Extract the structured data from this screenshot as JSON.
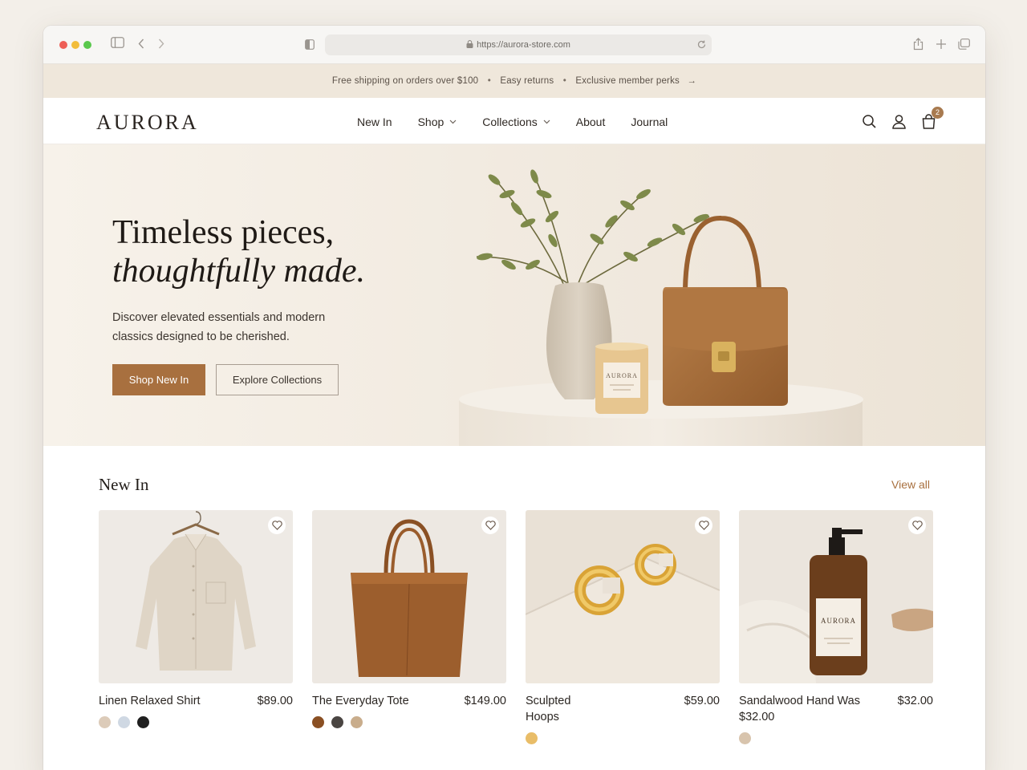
{
  "browser": {
    "url": "https://aurora-store.com"
  },
  "announcement": {
    "items": [
      "Free shipping on orders over $100",
      "Easy returns",
      "Exclusive member perks"
    ],
    "separator": "•",
    "arrow": "→"
  },
  "header": {
    "logo": "AURORA",
    "nav": [
      {
        "label": "New In",
        "has_dropdown": false
      },
      {
        "label": "Shop",
        "has_dropdown": true
      },
      {
        "label": "Collections",
        "has_dropdown": true
      },
      {
        "label": "About",
        "has_dropdown": false
      },
      {
        "label": "Journal",
        "has_dropdown": false
      }
    ],
    "icons": [
      "search-icon",
      "account-icon",
      "bag-icon"
    ],
    "cart_count": "2"
  },
  "hero": {
    "headline_line1": "Timeless pieces,",
    "headline_line2": "thoughtfully made.",
    "subtext": "Discover elevated essentials and modern classics designed to be cherished.",
    "primary_cta": "Shop New In",
    "secondary_cta": "Explore Collections",
    "candle_label": "AURORA"
  },
  "new_in": {
    "title": "New In",
    "view_all": "View all",
    "products": [
      {
        "name": "Linen Relaxed Shirt",
        "price": "$89.00",
        "swatches": [
          "#dccbb9",
          "#cfd8e3",
          "#1f1f1f"
        ]
      },
      {
        "name": "The Everyday Tote",
        "price": "$149.00",
        "swatches": [
          "#8a4f23",
          "#4a4542",
          "#c9ad8c"
        ]
      },
      {
        "name": "Sculpted Hoops",
        "price": "$59.00",
        "swatches": [
          "#e9bd68"
        ]
      },
      {
        "name": "Sandalwood Hand Was $32.00",
        "price": "$32.00",
        "swatches": [
          "#d8c4ad"
        ],
        "bottle_label": "AURORA"
      }
    ]
  },
  "colors": {
    "accent": "#a8703f",
    "announcement_bg": "#efe7db",
    "hero_bg": "#f2ebe1"
  }
}
